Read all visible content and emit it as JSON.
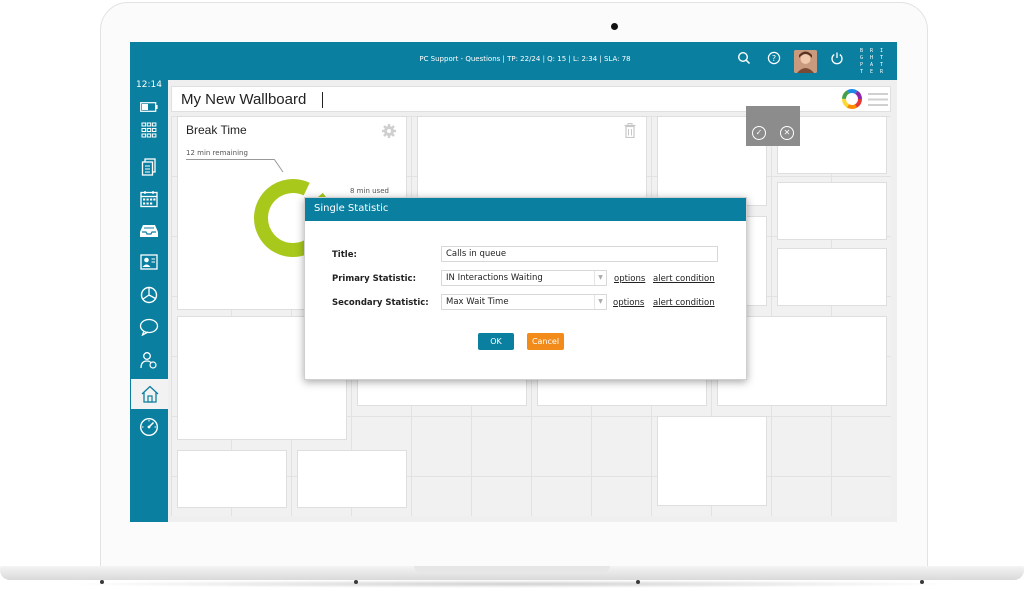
{
  "topbar": {
    "info": "PC Support - Questions | TP: 22/24 | Q: 15 | L: 2:34 | SLA: 78",
    "icons": [
      "search-icon",
      "help-icon",
      "avatar",
      "power-icon"
    ],
    "brand": "BRIGHTPATTERN"
  },
  "sidebar": {
    "clock": "12:14",
    "items": [
      "battery-icon",
      "dialpad-icon",
      "documents-icon",
      "calendar-icon",
      "inbox-icon",
      "contact-card-icon",
      "pie-chart-icon",
      "chat-icon",
      "agent-icon",
      "home-icon",
      "dashboard-icon"
    ],
    "active": "home-icon"
  },
  "wallboard": {
    "title": "My New Wallboard"
  },
  "widget": {
    "title": "Break Time",
    "remaining": "12 min remaining",
    "used": "8 min used",
    "remaining_value": 12,
    "used_value": 8,
    "colors": {
      "remaining": "#a8c81c",
      "used": "#ffffff"
    }
  },
  "dialog": {
    "title": "Single Statistic",
    "title_label": "Title:",
    "title_value": "Calls in queue",
    "primary_label": "Primary Statistic:",
    "primary_value": "IN Interactions Waiting",
    "secondary_label": "Secondary Statistic:",
    "secondary_value": "Max Wait Time",
    "options_label": "options",
    "alert_label": "alert condition",
    "ok_label": "OK",
    "cancel_label": "Cancel"
  },
  "colors": {
    "accent": "#0b7fa0",
    "cancel": "#f28b1a",
    "donut": "#a8c81c"
  }
}
